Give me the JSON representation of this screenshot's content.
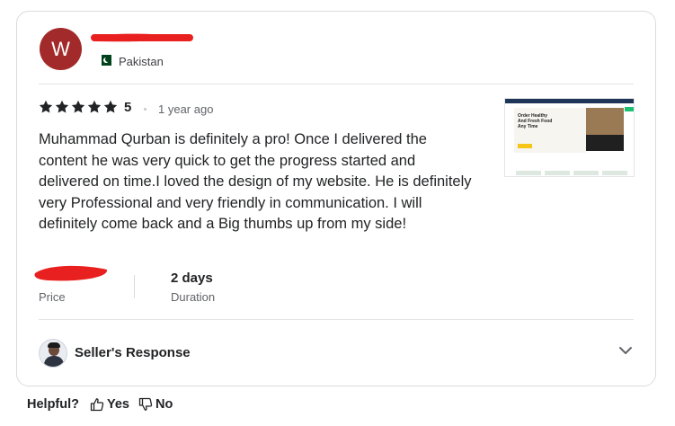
{
  "reviewer": {
    "avatar_letter": "W",
    "avatar_color": "#a32a2a",
    "country": "Pakistan"
  },
  "review": {
    "rating": "5",
    "time_ago": "1 year ago",
    "text": "Muhammad Qurban is definitely a pro! Once I delivered the content he was very quick to get the progress started and delivered on time.I loved the design of my website. He is definitely very Professional and very friendly in communication. I will definitely come back and a Big thumbs up from my side!"
  },
  "thumbnail": {
    "heading": "Order Healthy And Fresh Food Any Time"
  },
  "details": {
    "price_label": "Price",
    "duration_value": "2 days",
    "duration_label": "Duration"
  },
  "seller_response": {
    "label": "Seller's Response"
  },
  "helpful": {
    "label": "Helpful?",
    "yes": "Yes",
    "no": "No"
  },
  "colors": {
    "redaction": "#e8201f",
    "star": "#222325",
    "accent_green": "#1dbf73"
  },
  "icons": {
    "star": "star-icon",
    "chevron": "chevron-down-icon",
    "thumbs_up": "thumbs-up-icon",
    "thumbs_down": "thumbs-down-icon"
  }
}
